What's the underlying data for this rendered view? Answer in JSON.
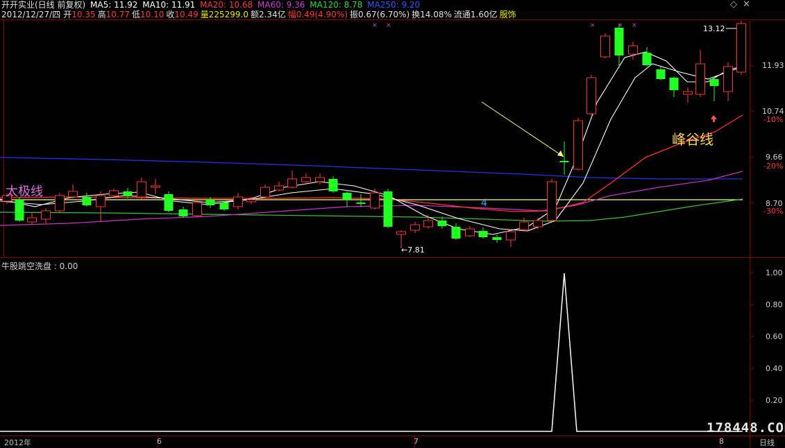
{
  "header": {
    "title": "开开实业(日线 前复权)",
    "ma5": "MA5: 11.92",
    "ma10": "MA10: 11.91",
    "ma20": "MA20: 10.68",
    "ma60": "MA60: 9.36",
    "ma120": "MA120: 8.78",
    "ma250": "MA250: 9.20"
  },
  "quote": {
    "date": "2012/12/27/四",
    "open_label": "开",
    "open": "10.35",
    "high_label": "高",
    "high": "10.77",
    "low_label": "低",
    "low": "10.10",
    "close_label": "收",
    "close": "10.49",
    "volume": "量225299.0",
    "amount": "额2.34亿",
    "change": "幅0.49(4.90%)",
    "amplitude": "振0.67(6.70%)",
    "turnover": "换14.08%",
    "float": "流通1.60亿",
    "apparel": "服饰"
  },
  "colors": {
    "ma5": "#ffffff",
    "ma10": "#ffff66",
    "ma20": "#ff3333",
    "ma60": "#cc33cc",
    "ma120": "#33cc33",
    "ma250": "#2244ff",
    "up": "#ff3333",
    "down": "#22ff22",
    "grid": "#8b0000"
  },
  "price_axis": {
    "labels": [
      "11.93",
      "10.74",
      "9.66",
      "8.70"
    ],
    "pct_labels": [
      "-10%",
      "-20%",
      "-30%"
    ]
  },
  "annotations": {
    "taiji": "太极线",
    "fenggu": "峰谷线",
    "high_mark": "13.12",
    "low_mark": "←7.81",
    "count_mark": "4"
  },
  "sub_chart": {
    "title": "牛股跳空洗盘 : 0.00",
    "axis_labels": [
      "1.00",
      "0.80",
      "0.60",
      "0.40",
      "0.20"
    ]
  },
  "time_axis": {
    "labels": [
      "2012年",
      "6",
      "7",
      "8"
    ],
    "period": "日线"
  },
  "window": {
    "diamond": "◇",
    "close": "✕"
  },
  "watermark": "178448.COM"
}
